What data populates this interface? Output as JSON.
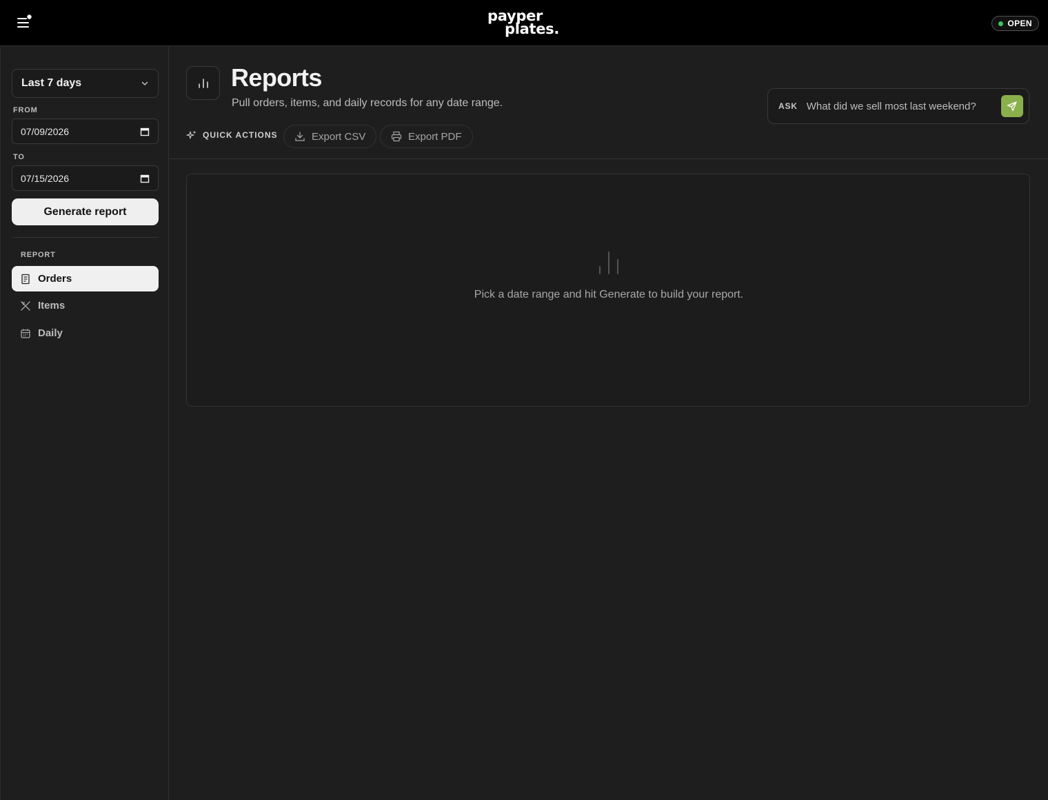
{
  "header": {
    "brand_line1": "payper",
    "brand_line2": "plates.",
    "status": "OPEN",
    "status_color": "#3ec65b"
  },
  "sidebar": {
    "range_select": "Last 7 days",
    "from_label": "FROM",
    "from_value": "07/09/2026",
    "to_label": "TO",
    "to_value": "07/15/2026",
    "generate_label": "Generate report",
    "report_section_label": "REPORT",
    "items": [
      {
        "label": "Orders",
        "icon": "receipt-icon",
        "active": true
      },
      {
        "label": "Items",
        "icon": "utensils-icon",
        "active": false
      },
      {
        "label": "Daily",
        "icon": "calendar-icon",
        "active": false
      }
    ]
  },
  "main": {
    "title": "Reports",
    "subtitle": "Pull orders, items, and daily records for any date range.",
    "quick_actions_label": "QUICK ACTIONS",
    "export_csv_label": "Export CSV",
    "export_pdf_label": "Export PDF",
    "ask_tag": "ASK",
    "ask_placeholder": "What did we sell most last weekend?",
    "ask_send_color": "#8ab04c",
    "empty_message": "Pick a date range and hit Generate to build your report."
  }
}
